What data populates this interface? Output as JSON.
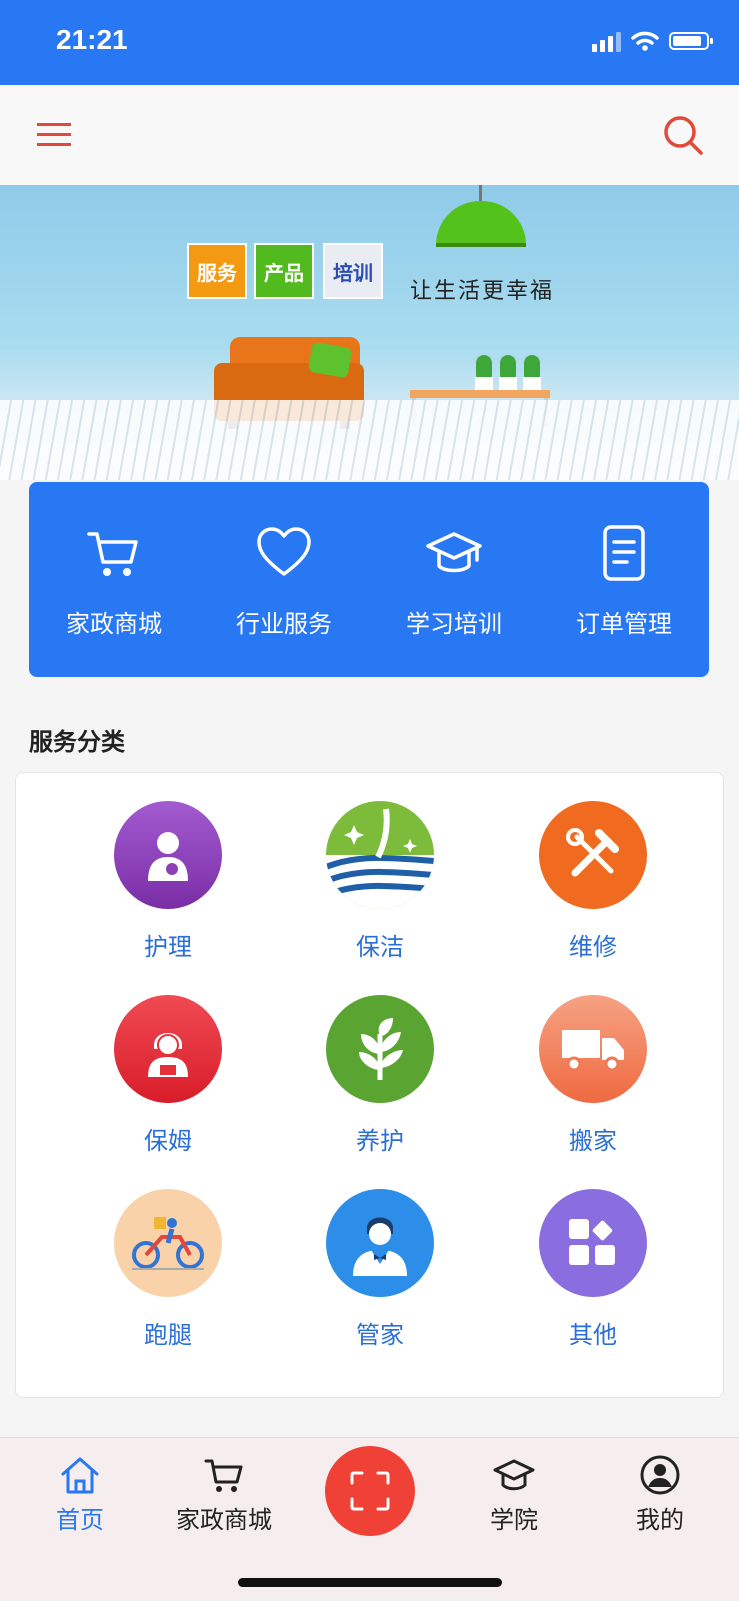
{
  "status": {
    "time": "21:21"
  },
  "banner": {
    "tags": [
      "服务",
      "产品",
      "培训"
    ],
    "slogan": "让生活更幸福"
  },
  "quick_links": [
    {
      "label": "家政商城",
      "icon": "cart-icon"
    },
    {
      "label": "行业服务",
      "icon": "heart-icon"
    },
    {
      "label": "学习培训",
      "icon": "graduation-cap-icon"
    },
    {
      "label": "订单管理",
      "icon": "document-icon"
    }
  ],
  "categories": {
    "title": "服务分类",
    "items": [
      {
        "label": "护理",
        "icon": "nurse-icon",
        "color": "#8e3fb6"
      },
      {
        "label": "保洁",
        "icon": "broom-icon",
        "color": "#6cb33f"
      },
      {
        "label": "维修",
        "icon": "tools-icon",
        "color": "#f06b1f"
      },
      {
        "label": "保姆",
        "icon": "nanny-icon",
        "color": "#e8303a"
      },
      {
        "label": "养护",
        "icon": "plant-icon",
        "color": "#5aa532"
      },
      {
        "label": "搬家",
        "icon": "truck-icon",
        "color": "#f4845f"
      },
      {
        "label": "跑腿",
        "icon": "delivery-bike-icon",
        "color": "#f7cfa8"
      },
      {
        "label": "管家",
        "icon": "butler-icon",
        "color": "#2c8ee8"
      },
      {
        "label": "其他",
        "icon": "grid-icon",
        "color": "#8a6ee0"
      }
    ]
  },
  "tab_bar": {
    "items": [
      {
        "label": "首页",
        "icon": "home-icon",
        "active": true
      },
      {
        "label": "家政商城",
        "icon": "cart-icon",
        "active": false
      },
      {
        "label": "学院",
        "icon": "graduation-cap-icon",
        "active": false
      },
      {
        "label": "我的",
        "icon": "user-icon",
        "active": false
      }
    ],
    "scan_icon": "scan-icon"
  }
}
